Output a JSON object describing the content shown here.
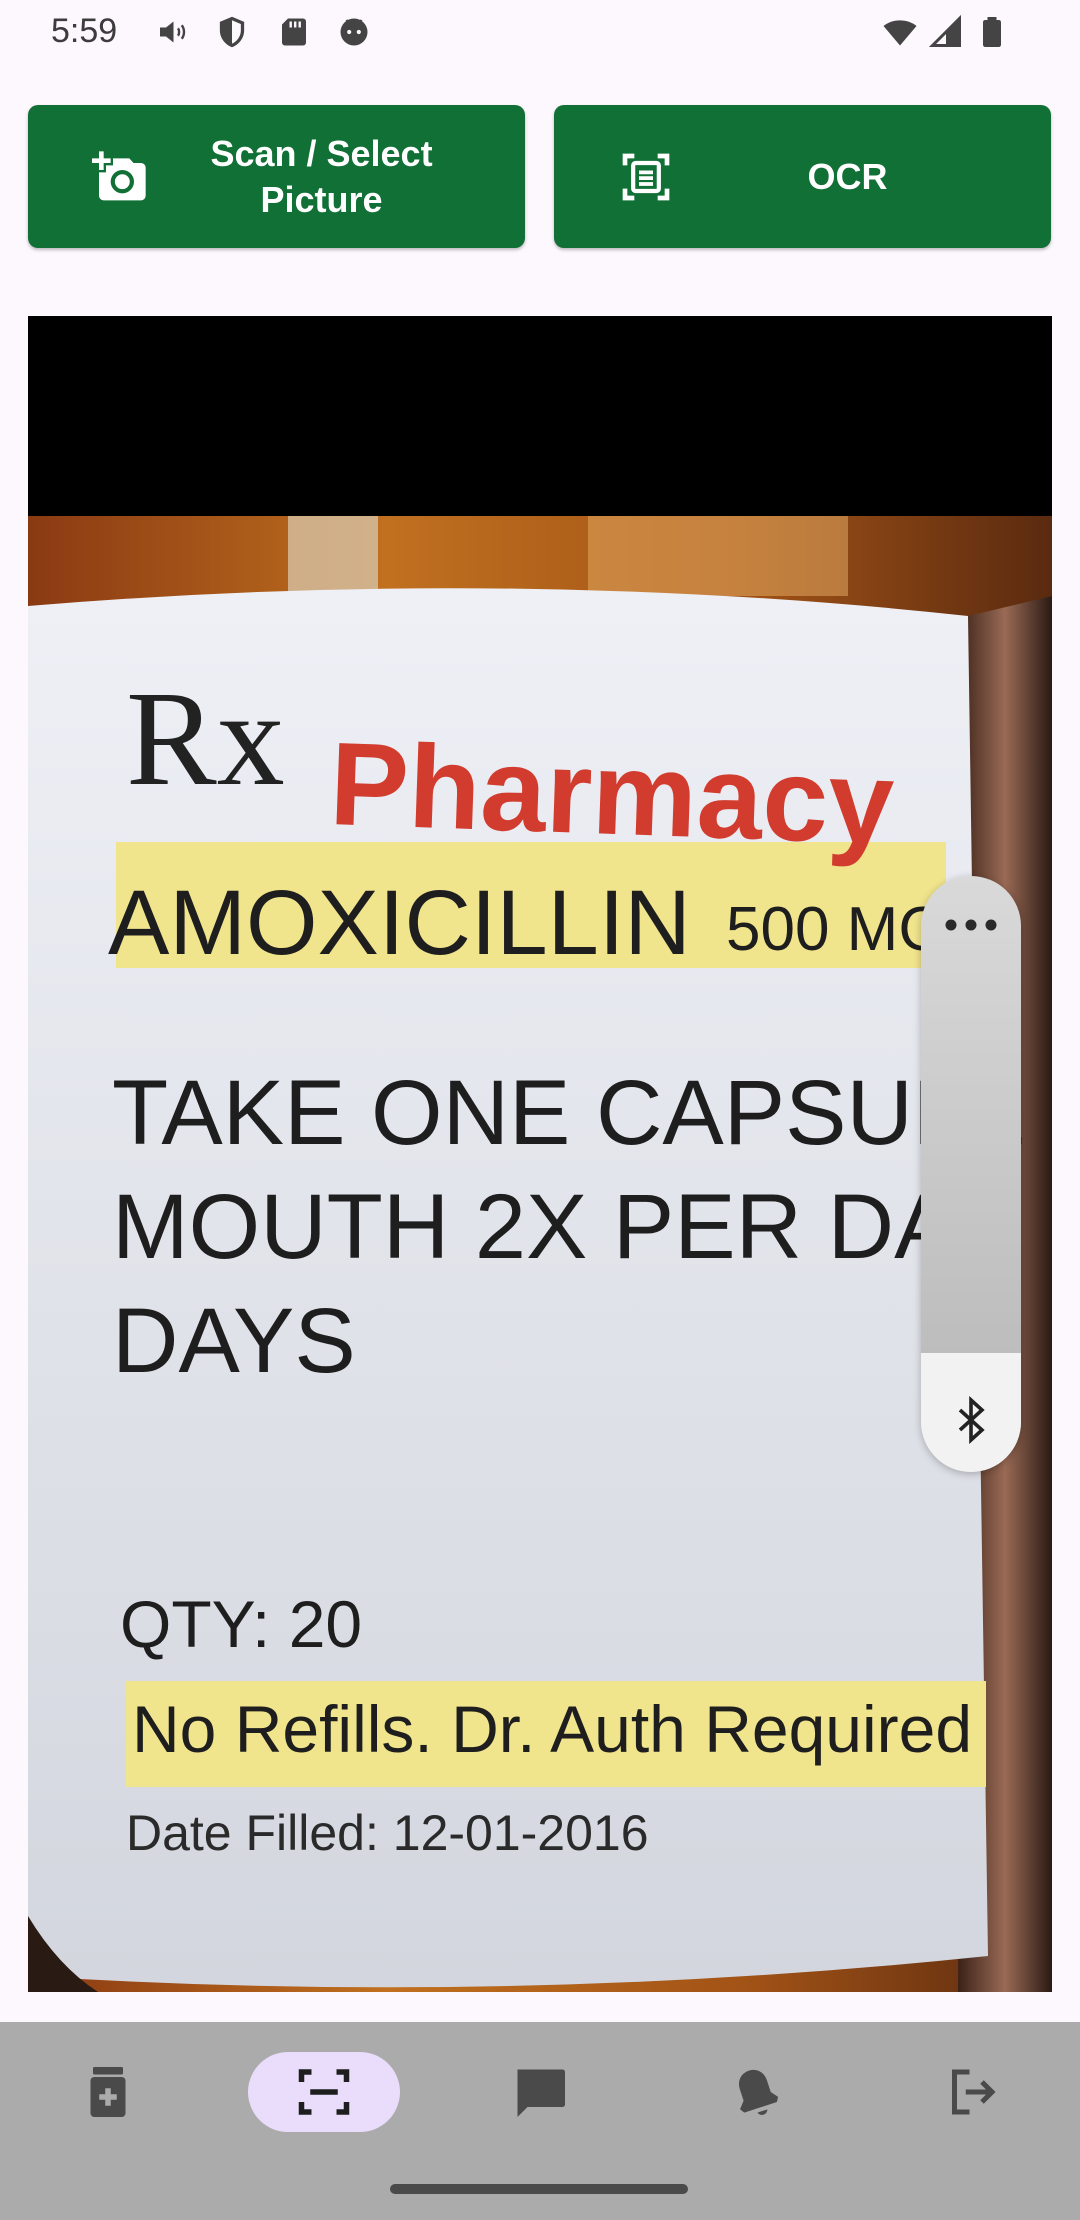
{
  "status_bar": {
    "time": "5:59",
    "left_icons": [
      "volume-vibrate-icon",
      "shield-icon",
      "sd-card-icon",
      "android-icon"
    ],
    "right_icons": [
      "wifi-icon",
      "signal-icon",
      "battery-icon"
    ]
  },
  "actions": {
    "scan_label": "Scan / Select\nPicture",
    "scan_icon": "add-a-photo-icon",
    "ocr_label": "OCR",
    "ocr_icon": "document-scanner-icon"
  },
  "photo": {
    "rx_symbol": "Rx",
    "pharmacy": "Pharmacy",
    "drug_name": "AMOXICILLIN",
    "dose": "500 MG",
    "directions_lines": [
      "TAKE ONE CAPSULE",
      "MOUTH 2X PER DAY",
      "DAYS"
    ],
    "qty": "QTY: 20",
    "refills": "No Refills.  Dr. Auth Required",
    "date_filled": "Date Filled: 12-01-2016"
  },
  "volume_panel": {
    "more_icon": "more-horiz-icon",
    "bluetooth_icon": "bluetooth-icon",
    "level": 0.2
  },
  "bottom_nav": {
    "items": [
      {
        "name": "medication",
        "icon": "medication-icon",
        "active": false
      },
      {
        "name": "scanner",
        "icon": "scanner-icon",
        "active": true
      },
      {
        "name": "chat",
        "icon": "chat-icon",
        "active": false
      },
      {
        "name": "reminders",
        "icon": "notifications-icon",
        "active": false
      },
      {
        "name": "logout",
        "icon": "logout-icon",
        "active": false
      }
    ]
  },
  "colors": {
    "primary": "#107035",
    "background": "#fdf7fe",
    "nav_background": "#ababab",
    "nav_active_pill": "#e9ddfb",
    "pharmacy_red": "#d23c2e",
    "label_highlight": "#f0e48c"
  }
}
